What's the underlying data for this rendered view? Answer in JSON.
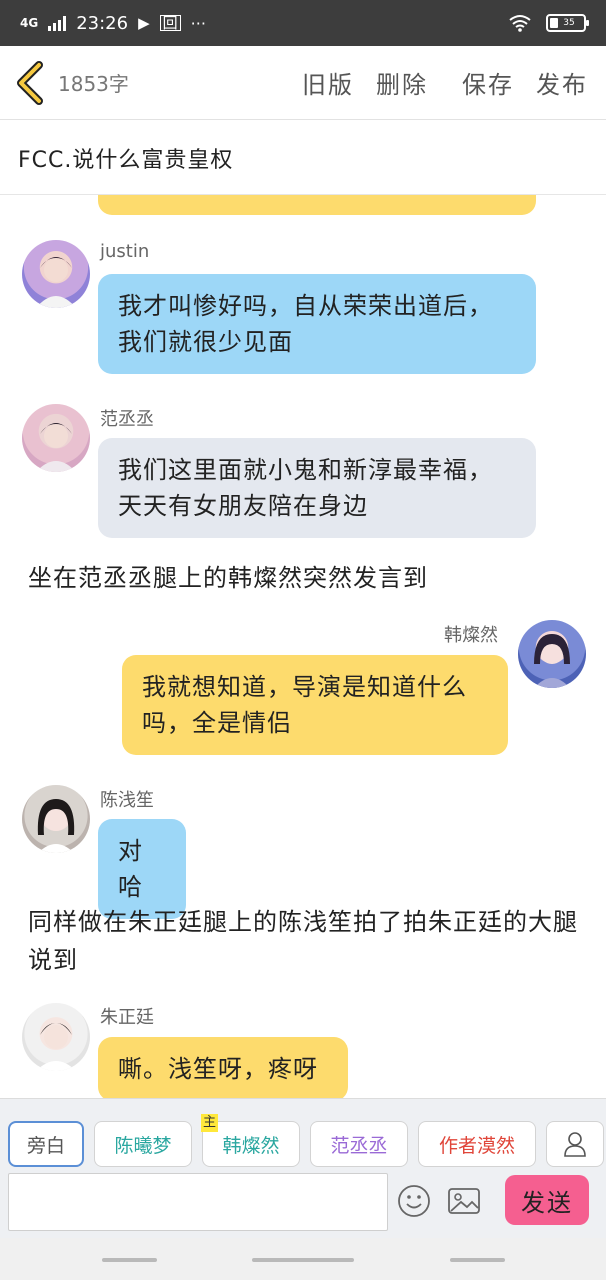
{
  "status_bar": {
    "network": "4G",
    "time": "23:26",
    "battery_level": "35"
  },
  "header": {
    "word_count": "1853字",
    "actions": [
      "旧版",
      "删除",
      "保存",
      "发布"
    ]
  },
  "title": "FCC.说什么富贵皇权",
  "messages": [
    {
      "sender": "justin",
      "text": "我才叫惨好吗，自从荣荣出道后，我们就很少见面"
    },
    {
      "sender": "范丞丞",
      "text": "我们这里面就小鬼和新淳最幸福，天天有女朋友陪在身边"
    },
    {
      "narration": "坐在范丞丞腿上的韩燦然突然发言到"
    },
    {
      "sender": "韩燦然",
      "text": "我就想知道，导演是知道什么吗，全是情侣"
    },
    {
      "sender": "陈浅笙",
      "text": "对哈"
    },
    {
      "narration": "同样做在朱正廷腿上的陈浅笙拍了拍朱正廷的大腿说到"
    },
    {
      "sender": "朱正廷",
      "text": "嘶。浅笙呀，疼呀"
    }
  ],
  "roles": [
    {
      "label": "旁白",
      "color": "#555555"
    },
    {
      "label": "陈曦梦",
      "color": "#2aa7a0"
    },
    {
      "label": "韩燦然",
      "color": "#2aa7a0",
      "tag": "主"
    },
    {
      "label": "范丞丞",
      "color": "#9a6ad6"
    },
    {
      "label": "作者漠然",
      "color": "#e0463a"
    }
  ],
  "input": {
    "placeholder": ""
  },
  "send_label": "发送",
  "icons": [
    "back-chevron-icon",
    "user-icon",
    "emoji-icon",
    "image-icon"
  ]
}
